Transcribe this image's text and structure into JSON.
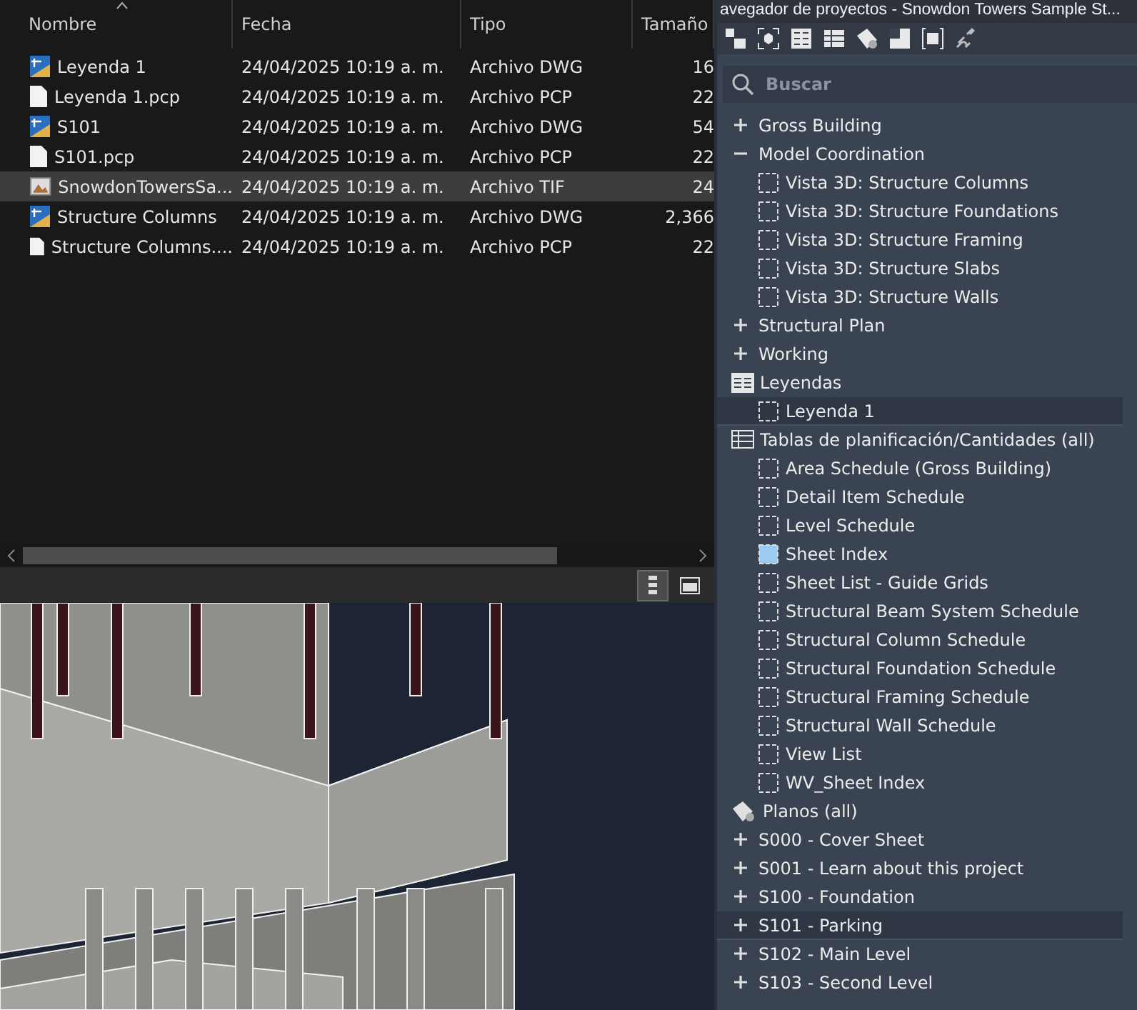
{
  "file_explorer": {
    "columns": [
      {
        "label": "Nombre",
        "sorted": true
      },
      {
        "label": "Fecha",
        "sorted": false
      },
      {
        "label": "Tipo",
        "sorted": false
      },
      {
        "label": "Tamaño",
        "sorted": false
      }
    ],
    "rows": [
      {
        "kind": "dwg",
        "name": "Leyenda 1",
        "date": "24/04/2025 10:19 a. m.",
        "type": "Archivo DWG",
        "size": "16",
        "selected": false
      },
      {
        "kind": "pcp",
        "name": "Leyenda 1.pcp",
        "date": "24/04/2025 10:19 a. m.",
        "type": "Archivo PCP",
        "size": "22",
        "selected": false
      },
      {
        "kind": "dwg",
        "name": "S101",
        "date": "24/04/2025 10:19 a. m.",
        "type": "Archivo DWG",
        "size": "54",
        "selected": false
      },
      {
        "kind": "pcp",
        "name": "S101.pcp",
        "date": "24/04/2025 10:19 a. m.",
        "type": "Archivo PCP",
        "size": "22",
        "selected": false
      },
      {
        "kind": "tif",
        "name": "SnowdonTowersSa...",
        "date": "24/04/2025 10:19 a. m.",
        "type": "Archivo TIF",
        "size": "24",
        "selected": true
      },
      {
        "kind": "dwg",
        "name": "Structure Columns",
        "date": "24/04/2025 10:19 a. m.",
        "type": "Archivo DWG",
        "size": "2,366",
        "selected": false
      },
      {
        "kind": "pcp",
        "name": "Structure Columns....",
        "date": "24/04/2025 10:19 a. m.",
        "type": "Archivo PCP",
        "size": "22",
        "selected": false
      }
    ],
    "view_buttons": [
      {
        "kind": "details",
        "selected": true
      },
      {
        "kind": "preview",
        "selected": false
      }
    ]
  },
  "project_browser": {
    "title": "avegador de proyectos - Snowdon Towers Sample St...",
    "search": {
      "placeholder": "Buscar"
    },
    "tree": [
      {
        "kind": "folder",
        "label": "Gross Building",
        "expanded": false,
        "selected": false
      },
      {
        "kind": "folder",
        "label": "Model Coordination",
        "expanded": true,
        "selected": false,
        "children": [
          {
            "kind": "view",
            "label": "Vista 3D: Structure Columns",
            "selected": false
          },
          {
            "kind": "view",
            "label": "Vista 3D: Structure Foundations",
            "selected": false
          },
          {
            "kind": "view",
            "label": "Vista 3D: Structure Framing",
            "selected": false
          },
          {
            "kind": "view",
            "label": "Vista 3D: Structure Slabs",
            "selected": false
          },
          {
            "kind": "view",
            "label": "Vista 3D: Structure Walls",
            "selected": false
          }
        ]
      },
      {
        "kind": "folder",
        "label": "Structural Plan",
        "expanded": false,
        "selected": false
      },
      {
        "kind": "folder",
        "label": "Working",
        "expanded": false,
        "selected": false
      },
      {
        "kind": "legends",
        "label": "Leyendas",
        "expanded": true,
        "selected": false,
        "children": [
          {
            "kind": "view",
            "label": "Leyenda 1",
            "selected": true
          }
        ]
      },
      {
        "kind": "schedules",
        "label": "Tablas de planificación/Cantidades (all)",
        "expanded": true,
        "selected": false,
        "children": [
          {
            "kind": "view",
            "label": "Area Schedule (Gross Building)",
            "selected": false
          },
          {
            "kind": "view",
            "label": "Detail Item Schedule",
            "selected": false
          },
          {
            "kind": "view",
            "label": "Level Schedule",
            "selected": false
          },
          {
            "kind": "open-view",
            "label": "Sheet Index",
            "selected": false
          },
          {
            "kind": "view",
            "label": "Sheet List - Guide Grids",
            "selected": false
          },
          {
            "kind": "view",
            "label": "Structural Beam System Schedule",
            "selected": false
          },
          {
            "kind": "view",
            "label": "Structural Column Schedule",
            "selected": false
          },
          {
            "kind": "view",
            "label": "Structural Foundation Schedule",
            "selected": false
          },
          {
            "kind": "view",
            "label": "Structural Framing Schedule",
            "selected": false
          },
          {
            "kind": "view",
            "label": "Structural Wall Schedule",
            "selected": false
          },
          {
            "kind": "view",
            "label": "View List",
            "selected": false
          },
          {
            "kind": "view",
            "label": "WV_Sheet Index",
            "selected": false
          }
        ]
      },
      {
        "kind": "sheets",
        "label": "Planos (all)",
        "expanded": true,
        "selected": false,
        "children": [
          {
            "kind": "folder",
            "label": "S000 - Cover Sheet",
            "expanded": false,
            "selected": false
          },
          {
            "kind": "folder",
            "label": "S001 - Learn about this project",
            "expanded": false,
            "selected": false
          },
          {
            "kind": "folder",
            "label": "S100 - Foundation",
            "expanded": false,
            "selected": false
          },
          {
            "kind": "folder",
            "label": "S101 - Parking",
            "expanded": false,
            "selected": true
          },
          {
            "kind": "folder",
            "label": "S102 - Main Level",
            "expanded": false,
            "selected": false
          },
          {
            "kind": "folder",
            "label": "S103 - Second Level",
            "expanded": false,
            "selected": false
          }
        ]
      }
    ]
  }
}
